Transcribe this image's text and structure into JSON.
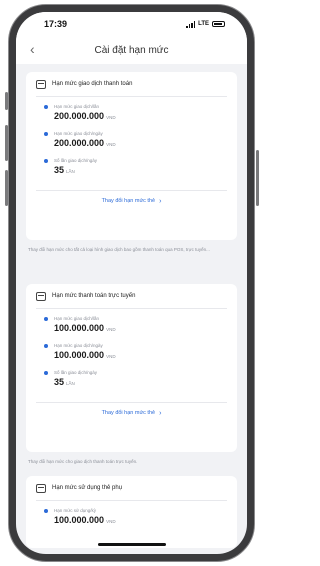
{
  "status_bar": {
    "time": "17:39",
    "network": "LTE"
  },
  "header": {
    "back_icon": "chevron-left-icon",
    "title": "Cài đặt hạn mức"
  },
  "cards": [
    {
      "icon": "payment-terminal-icon",
      "title": "Hạn mức giao dịch thanh toán",
      "limits": [
        {
          "label": "Hạn mức giao dịch/lần",
          "value": "200.000.000",
          "unit": "VND"
        },
        {
          "label": "Hạn mức giao dịch/ngày",
          "value": "200.000.000",
          "unit": "VND"
        },
        {
          "label": "Số lần giao dịch/ngày",
          "value": "35",
          "unit": "LẦN"
        }
      ],
      "button": "Thay đổi hạn mức thẻ",
      "note": "Thay đổi hạn mức cho tất cả loại hình giao dịch bao gồm thanh toán qua POS, trực tuyến..."
    },
    {
      "icon": "online-payment-icon",
      "title": "Hạn mức thanh toán trực tuyến",
      "limits": [
        {
          "label": "Hạn mức giao dịch/lần",
          "value": "100.000.000",
          "unit": "VND"
        },
        {
          "label": "Hạn mức giao dịch/ngày",
          "value": "100.000.000",
          "unit": "VND"
        },
        {
          "label": "Số lần giao dịch/ngày",
          "value": "35",
          "unit": "LẦN"
        }
      ],
      "button": "Thay đổi hạn mức thẻ",
      "note": "Thay đổi hạn mức cho giao dịch thanh toán trực tuyến."
    },
    {
      "icon": "card-icon",
      "title": "Hạn mức sử dụng thẻ phụ",
      "limits": [
        {
          "label": "Hạn mức sử dụng/kỳ",
          "value": "100.000.000",
          "unit": "VND"
        }
      ]
    }
  ],
  "colors": {
    "accent": "#2b6ad8",
    "background": "#f1f2f5",
    "card": "#ffffff"
  }
}
